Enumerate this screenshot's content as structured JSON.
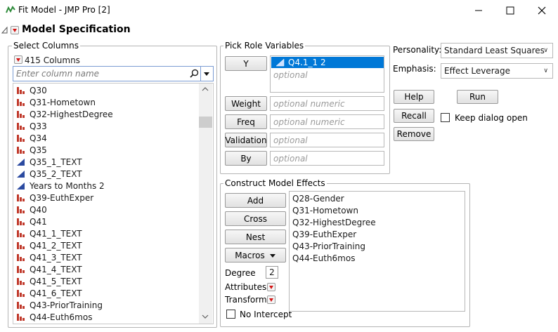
{
  "window": {
    "title": "Fit Model - JMP Pro [2]",
    "controls": {
      "minimize": "–",
      "maximize": "☐",
      "close": "✕"
    }
  },
  "header": {
    "title": "Model Specification"
  },
  "select_columns": {
    "group_label": "Select Columns",
    "count_label": "415 Columns",
    "search_placeholder": "Enter column name",
    "items": [
      {
        "name": "Q30",
        "type": "nominal-bar-icon"
      },
      {
        "name": "Q31-Hometown",
        "type": "nominal-bar-icon"
      },
      {
        "name": "Q32-HighestDegree",
        "type": "nominal-bar-icon"
      },
      {
        "name": "Q33",
        "type": "nominal-bar-icon"
      },
      {
        "name": "Q34",
        "type": "nominal-bar-icon"
      },
      {
        "name": "Q35",
        "type": "nominal-bar-icon"
      },
      {
        "name": "Q35_1_TEXT",
        "type": "continuous-triangle-icon"
      },
      {
        "name": "Q35_2_TEXT",
        "type": "continuous-triangle-icon"
      },
      {
        "name": "Years to Months 2",
        "type": "continuous-triangle-icon"
      },
      {
        "name": "Q39-EuthExper",
        "type": "nominal-bar-icon"
      },
      {
        "name": "Q40",
        "type": "nominal-bar-icon"
      },
      {
        "name": "Q41",
        "type": "nominal-bar-icon"
      },
      {
        "name": "Q41_1_TEXT",
        "type": "nominal-bar-icon"
      },
      {
        "name": "Q41_2_TEXT",
        "type": "nominal-bar-icon"
      },
      {
        "name": "Q41_3_TEXT",
        "type": "nominal-bar-icon"
      },
      {
        "name": "Q41_4_TEXT",
        "type": "nominal-bar-icon"
      },
      {
        "name": "Q41_5_TEXT",
        "type": "nominal-bar-icon"
      },
      {
        "name": "Q41_6_TEXT",
        "type": "nominal-bar-icon"
      },
      {
        "name": "Q43-PriorTraining",
        "type": "nominal-bar-icon"
      },
      {
        "name": "Q44-Euth6mos",
        "type": "nominal-bar-icon"
      }
    ]
  },
  "pick_roles": {
    "group_label": "Pick Role Variables",
    "y_button": "Y",
    "y_selected": "Q4.1_1 2",
    "y_placeholder": "optional",
    "weight_button": "Weight",
    "weight_placeholder": "optional numeric",
    "freq_button": "Freq",
    "freq_placeholder": "optional numeric",
    "validation_button": "Validation",
    "validation_placeholder": "optional",
    "by_button": "By",
    "by_placeholder": "optional"
  },
  "settings": {
    "personality_label": "Personality:",
    "personality_value": "Standard Least Squares",
    "emphasis_label": "Emphasis:",
    "emphasis_value": "Effect Leverage",
    "help_button": "Help",
    "run_button": "Run",
    "recall_button": "Recall",
    "keep_open_label": "Keep dialog open",
    "remove_button": "Remove"
  },
  "effects": {
    "group_label": "Construct Model Effects",
    "add_button": "Add",
    "cross_button": "Cross",
    "nest_button": "Nest",
    "macros_button": "Macros",
    "degree_label": "Degree",
    "degree_value": "2",
    "attributes_label": "Attributes",
    "transform_label": "Transform",
    "no_intercept_label": "No Intercept",
    "items": [
      "Q28-Gender",
      "Q31-Hometown",
      "Q32-HighestDegree",
      "Q39-EuthExper",
      "Q43-PriorTraining",
      "Q44-Euth6mos"
    ]
  },
  "colors": {
    "selection": "#0078d7",
    "red_triangle": "#d31515",
    "nominal_icon": "#c0392b",
    "continuous_icon": "#2b4aa0"
  }
}
